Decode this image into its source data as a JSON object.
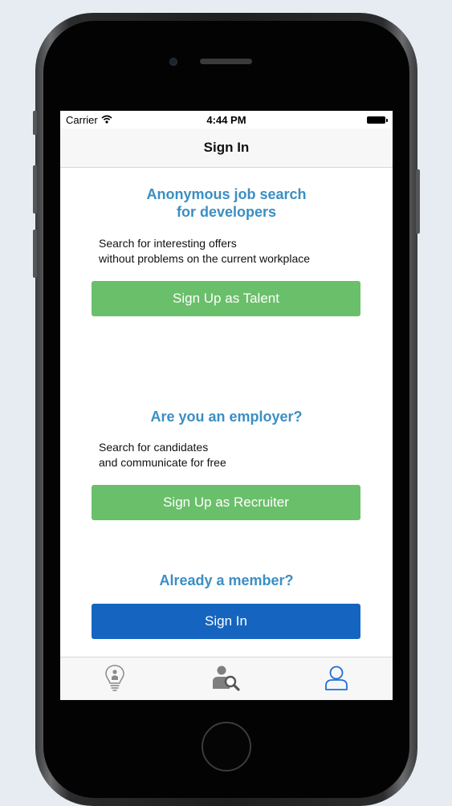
{
  "status_bar": {
    "carrier": "Carrier",
    "time": "4:44 PM",
    "icons": [
      "wifi-icon",
      "battery-icon"
    ]
  },
  "nav": {
    "title": "Sign In"
  },
  "talent_section": {
    "heading_line1": "Anonymous job search",
    "heading_line2": "for developers",
    "desc_line1": "Search for interesting offers",
    "desc_line2": "without problems on the current workplace",
    "button_label": "Sign Up as Talent"
  },
  "employer_section": {
    "heading": "Are you an employer?",
    "desc_line1": "Search for candidates",
    "desc_line2": "and communicate for free",
    "button_label": "Sign Up as Recruiter"
  },
  "member_section": {
    "heading": "Already a member?",
    "button_label": "Sign In"
  },
  "tab_bar": {
    "tabs": [
      {
        "icon": "lightbulb-person-icon",
        "selected": false
      },
      {
        "icon": "recruiter-search-icon",
        "selected": false
      },
      {
        "icon": "user-profile-icon",
        "selected": true
      }
    ]
  },
  "colors": {
    "heading_blue": "#3b8ec4",
    "green_button": "#6abf6a",
    "blue_button": "#1565c0",
    "tab_selected": "#1e6fd9",
    "tab_unselected": "#8a8a8a"
  }
}
